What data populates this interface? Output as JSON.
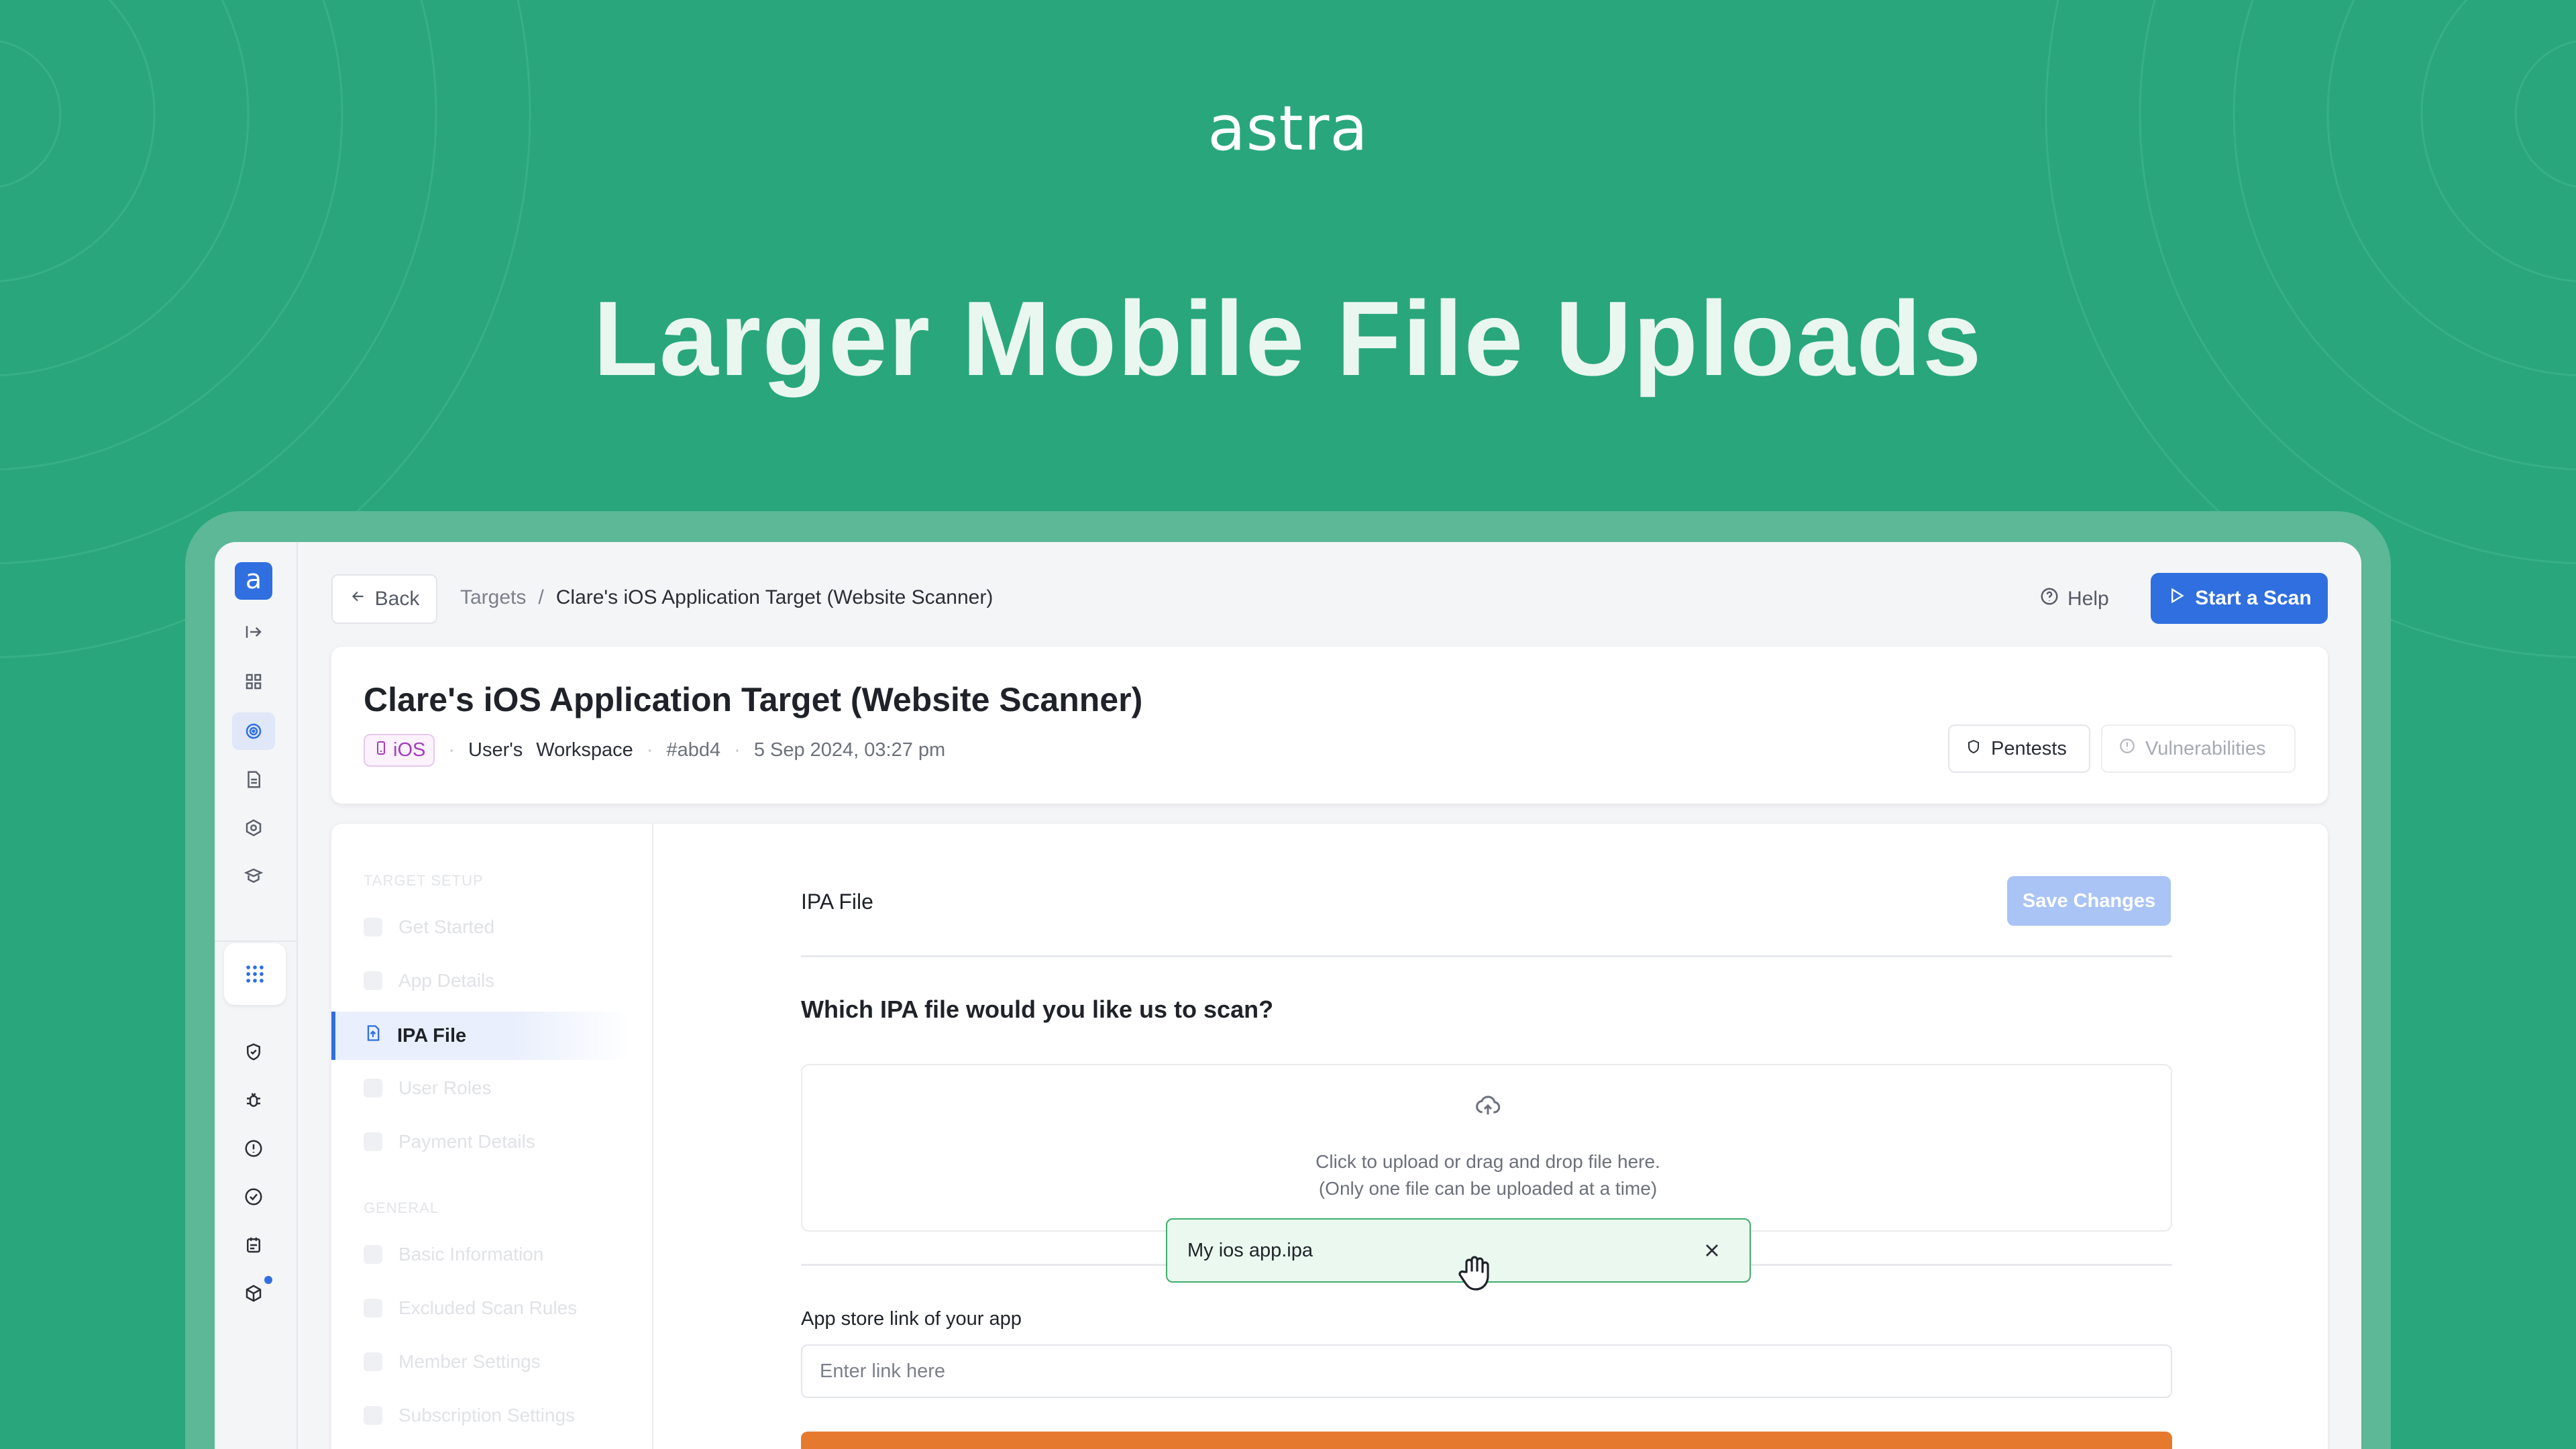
{
  "brand": {
    "logo": "astra"
  },
  "headline": "Larger Mobile File Uploads",
  "rail": {
    "logo_letter": "a"
  },
  "topbar": {
    "back_label": "Back",
    "breadcrumb_root": "Targets",
    "breadcrumb_sep": "/",
    "breadcrumb_current": "Clare's iOS Application Target (Website Scanner)",
    "help_label": "Help",
    "start_scan_label": "Start a Scan"
  },
  "header": {
    "title": "Clare's iOS Application Target (Website Scanner)",
    "platform_badge": "iOS",
    "workspace_owner": "User's",
    "workspace_label": "Workspace",
    "target_id": "#abd4",
    "created_at": "5 Sep 2024, 03:27 pm",
    "pentests_label": "Pentests",
    "vulnerabilities_label": "Vulnerabilities"
  },
  "sidebar": {
    "section_setup": "TARGET SETUP",
    "section_general": "GENERAL",
    "items": [
      {
        "label": "Get Started"
      },
      {
        "label": "App Details"
      },
      {
        "label": "IPA File"
      },
      {
        "label": "User Roles"
      },
      {
        "label": "Payment Details"
      },
      {
        "label": "Basic Information"
      },
      {
        "label": "Excluded Scan Rules"
      },
      {
        "label": "Member Settings"
      },
      {
        "label": "Subscription Settings"
      }
    ]
  },
  "form": {
    "section_title": "IPA File",
    "save_label": "Save Changes",
    "question": "Which IPA file would you like us to scan?",
    "dropzone_line1": "Click to upload or drag and drop file here.",
    "dropzone_line2": "(Only one file can be uploaded at a time)",
    "uploaded_file": "My ios app.ipa",
    "app_store_label": "App store link of your app",
    "app_store_placeholder": "Enter link here",
    "app_store_value": ""
  },
  "colors": {
    "background": "#29a67c",
    "accent": "#2f6fe0",
    "ios_badge": "#a33dbb",
    "file_chip_border": "#3fae6e",
    "orange": "#e57a2f"
  }
}
